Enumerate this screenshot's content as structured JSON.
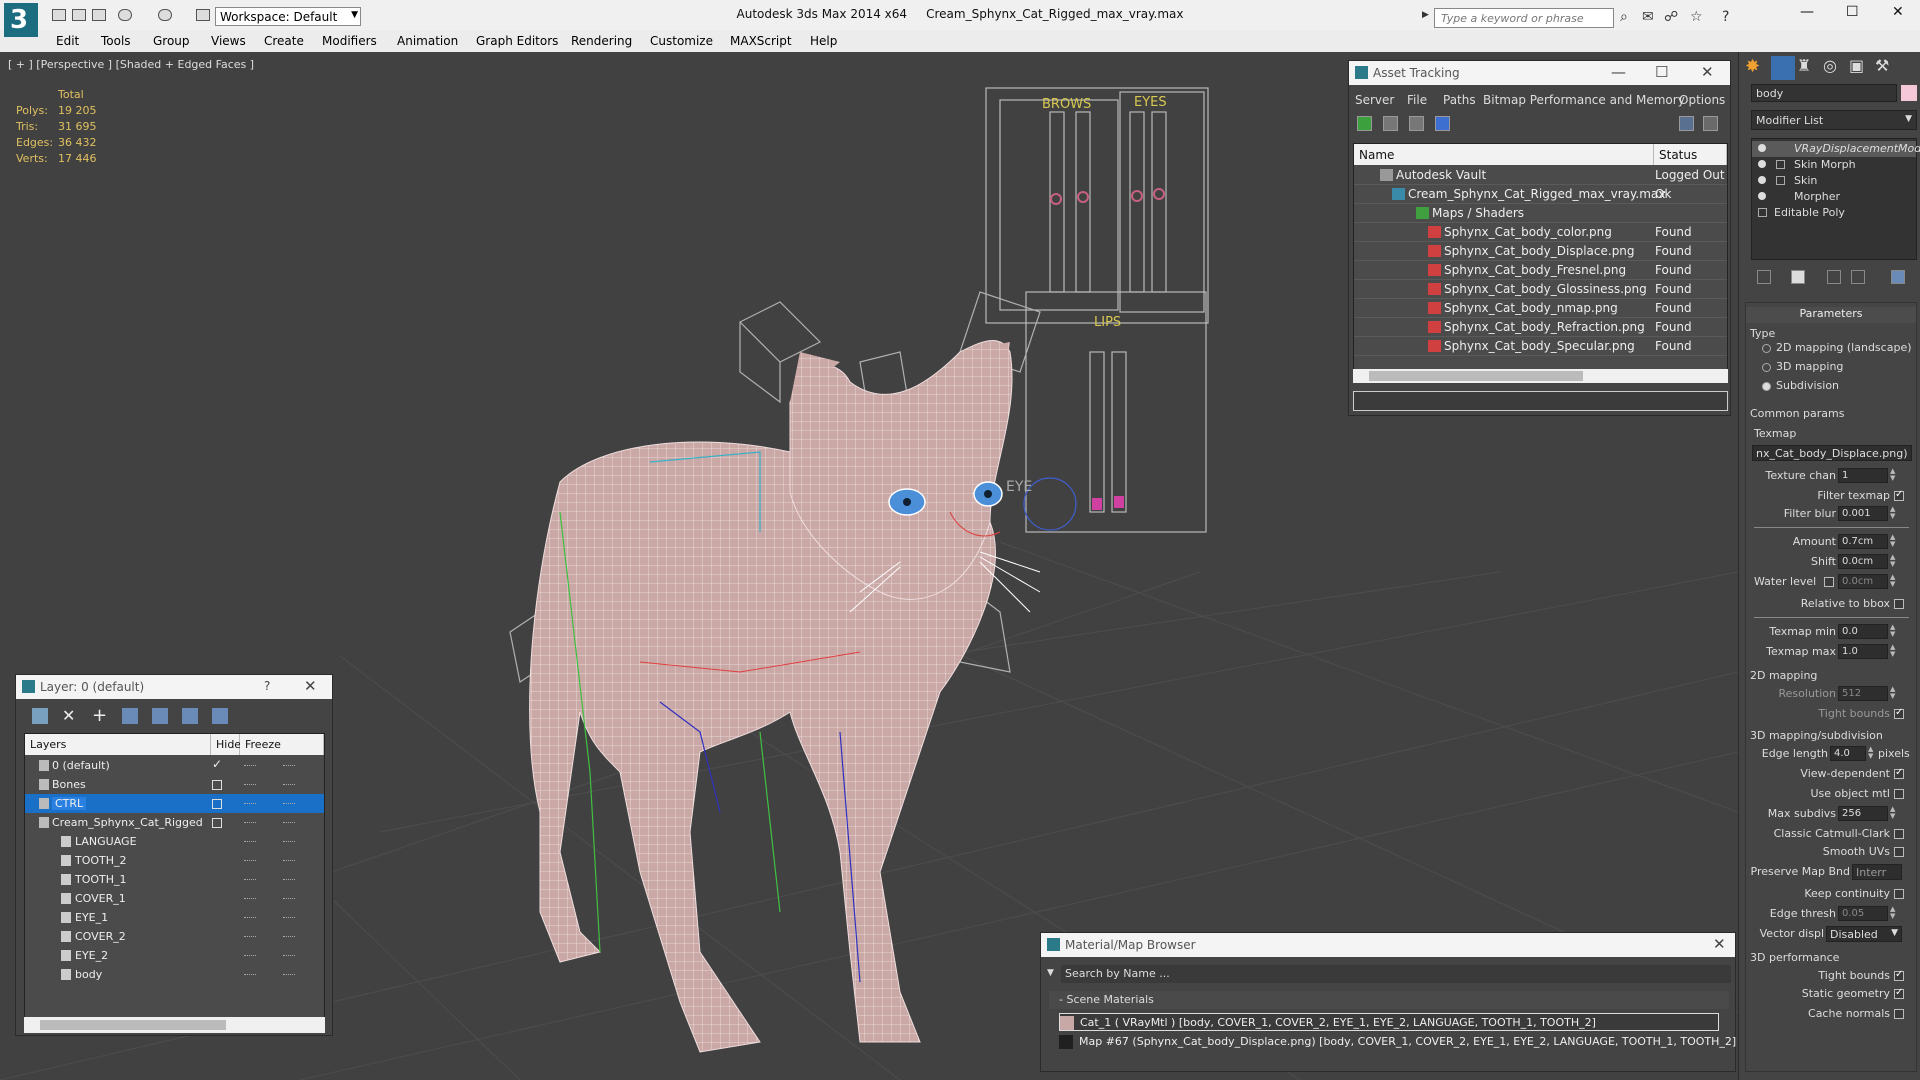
{
  "titlebar": {
    "workspace": "Workspace: Default",
    "app": "Autodesk 3ds Max  2014 x64",
    "file": "Cream_Sphynx_Cat_Rigged_max_vray.max",
    "search_placeholder": "Type a keyword or phrase"
  },
  "menu": [
    "Edit",
    "Tools",
    "Group",
    "Views",
    "Create",
    "Modifiers",
    "Animation",
    "Graph Editors",
    "Rendering",
    "Customize",
    "MAXScript",
    "Help"
  ],
  "viewport": {
    "label": "[ + ] [Perspective ] [Shaded + Edged Faces ]",
    "stats": {
      "header": "Total",
      "rows": [
        {
          "k": "Polys:",
          "v": "19 205"
        },
        {
          "k": "Tris:",
          "v": "31 695"
        },
        {
          "k": "Edges:",
          "v": "36 432"
        },
        {
          "k": "Verts:",
          "v": "17 446"
        }
      ]
    },
    "board_labels": {
      "brows": "BROWS",
      "eyes": "EYES",
      "lips": "LIPS",
      "eye": "EYE"
    }
  },
  "asset_tracking": {
    "title": "Asset Tracking",
    "menu": [
      "Server",
      "File",
      "Paths",
      "Bitmap Performance and Memory",
      "Options"
    ],
    "columns": {
      "name": "Name",
      "status": "Status"
    },
    "rows": [
      {
        "name": "Autodesk Vault",
        "status": "Logged Out ..."
      },
      {
        "name": "Cream_Sphynx_Cat_Rigged_max_vray.max",
        "status": "Ok"
      },
      {
        "name": "Maps / Shaders",
        "status": ""
      },
      {
        "name": "Sphynx_Cat_body_color.png",
        "status": "Found"
      },
      {
        "name": "Sphynx_Cat_body_Displace.png",
        "status": "Found"
      },
      {
        "name": "Sphynx_Cat_body_Fresnel.png",
        "status": "Found"
      },
      {
        "name": "Sphynx_Cat_body_Glossiness.png",
        "status": "Found"
      },
      {
        "name": "Sphynx_Cat_body_nmap.png",
        "status": "Found"
      },
      {
        "name": "Sphynx_Cat_body_Refraction.png",
        "status": "Found"
      },
      {
        "name": "Sphynx_Cat_body_Specular.png",
        "status": "Found"
      }
    ]
  },
  "layer_window": {
    "title": "Layer: 0 (default)",
    "columns": {
      "layers": "Layers",
      "hide": "Hide",
      "freeze": "Freeze"
    },
    "rows": [
      {
        "name": "0 (default)"
      },
      {
        "name": "Bones"
      },
      {
        "name": "CTRL"
      },
      {
        "name": "Cream_Sphynx_Cat_Rigged"
      },
      {
        "name": "LANGUAGE"
      },
      {
        "name": "TOOTH_2"
      },
      {
        "name": "TOOTH_1"
      },
      {
        "name": "COVER_1"
      },
      {
        "name": "EYE_1"
      },
      {
        "name": "COVER_2"
      },
      {
        "name": "EYE_2"
      },
      {
        "name": "body"
      }
    ]
  },
  "material_browser": {
    "title": "Material/Map Browser",
    "search": "Search by Name ...",
    "section": "- Scene Materials",
    "rows": [
      "Cat_1  ( VRayMtl )  [body, COVER_1, COVER_2, EYE_1, EYE_2, LANGUAGE, TOOTH_1, TOOTH_2]",
      "Map #67 (Sphynx_Cat_body_Displace.png)  [body, COVER_1, COVER_2, EYE_1, EYE_2, LANGUAGE, TOOTH_1, TOOTH_2]"
    ]
  },
  "command_panel": {
    "object_name": "body",
    "modifier_list": "Modifier List",
    "stack": [
      "VRayDisplacementMod",
      "Skin Morph",
      "Skin",
      "Morpher",
      "Editable Poly"
    ],
    "rollout": "Parameters",
    "type_group": "Type",
    "type_options": [
      "2D mapping (landscape)",
      "3D mapping",
      "Subdivision"
    ],
    "common_group": "Common params",
    "texmap_label": "Texmap",
    "texmap_value": "nx_Cat_body_Displace.png)",
    "texture_chan_label": "Texture chan",
    "texture_chan": "1",
    "filter_texmap_label": "Filter texmap",
    "filter_blur_label": "Filter blur",
    "filter_blur": "0.001",
    "amount_label": "Amount",
    "amount": "0.7cm",
    "shift_label": "Shift",
    "shift": "0.0cm",
    "water_level_label": "Water level",
    "water_level": "0.0cm",
    "relative_bbox_label": "Relative to bbox",
    "texmap_min_label": "Texmap min",
    "texmap_min": "0.0",
    "texmap_max_label": "Texmap max",
    "texmap_max": "1.0",
    "mapping2d_group": "2D mapping",
    "resolution_label": "Resolution",
    "resolution": "512",
    "tight_bounds_label": "Tight bounds",
    "mapping3d_group": "3D mapping/subdivision",
    "edge_length_label": "Edge length",
    "edge_length": "4.0",
    "pixels_label": "pixels",
    "view_dependent_label": "View-dependent",
    "use_object_mtl_label": "Use object mtl",
    "max_subdivs_label": "Max subdivs",
    "max_subdivs": "256",
    "classic_cc_label": "Classic Catmull-Clark",
    "smooth_uvs_label": "Smooth UVs",
    "preserve_map_label": "Preserve Map Bnd",
    "preserve_map_value": "Interr",
    "keep_continuity_label": "Keep continuity",
    "edge_thresh_label": "Edge thresh",
    "edge_thresh": "0.05",
    "vector_displ_label": "Vector displ",
    "vector_displ_value": "Disabled",
    "perf_group": "3D performance",
    "tight_bounds2_label": "Tight bounds",
    "static_geom_label": "Static geometry",
    "cache_normals_label": "Cache normals"
  },
  "colors": {
    "accent": "#1d6d80",
    "selection": "#1a6fc7",
    "stats": "#e0c060"
  }
}
